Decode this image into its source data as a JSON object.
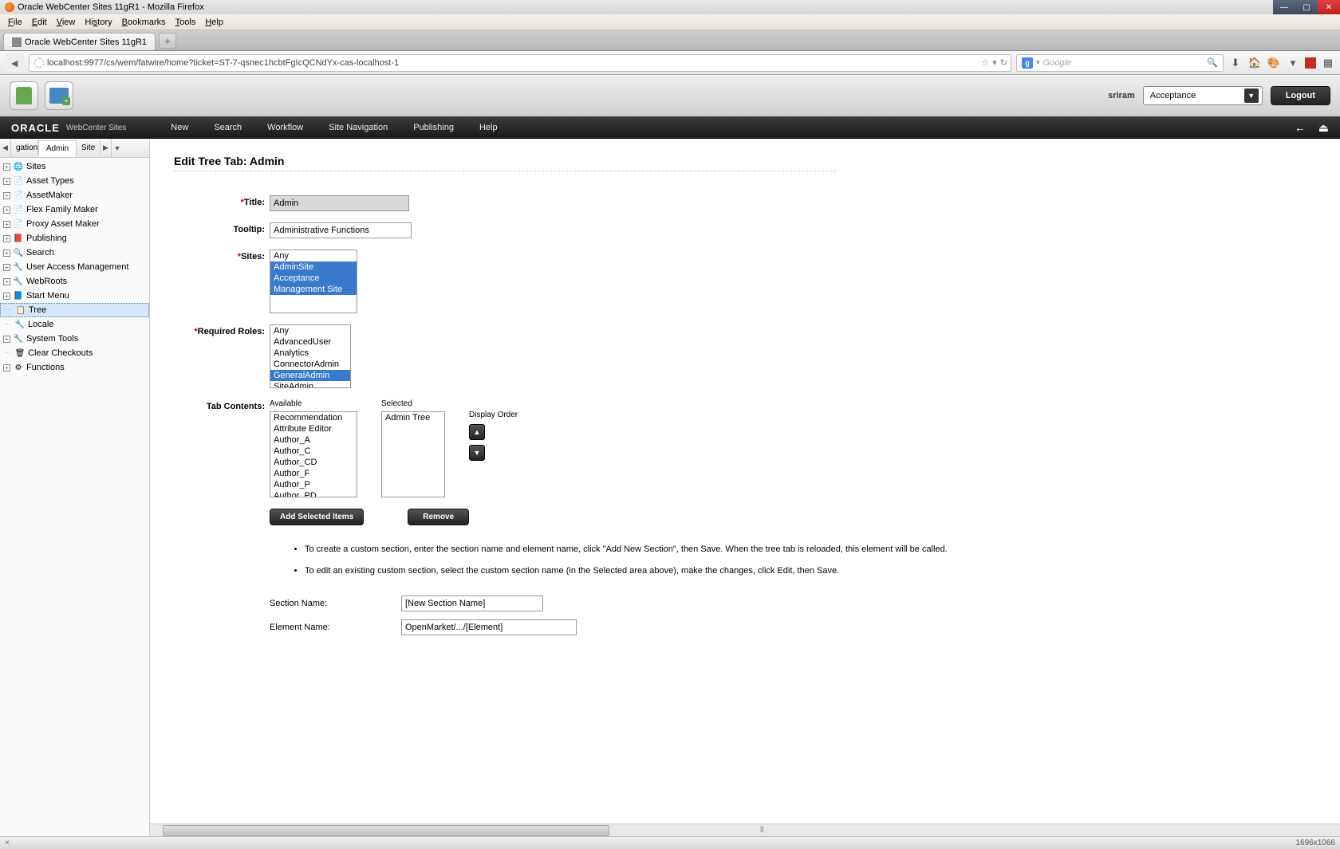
{
  "window": {
    "title": "Oracle WebCenter Sites 11gR1 - Mozilla Firefox"
  },
  "menubar": [
    "File",
    "Edit",
    "View",
    "History",
    "Bookmarks",
    "Tools",
    "Help"
  ],
  "tab": {
    "label": "Oracle WebCenter Sites 11gR1"
  },
  "url": "localhost:9977/cs/wem/fatwire/home?ticket=ST-7-qsnec1hcbtFgIcQCNdYx-cas-localhost-1",
  "search_placeholder": "Google",
  "user": "sriram",
  "site_select": "Acceptance",
  "logout": "Logout",
  "brand": {
    "name": "ORACLE",
    "product": "WebCenter Sites"
  },
  "topnav": [
    "New",
    "Search",
    "Workflow",
    "Site Navigation",
    "Publishing",
    "Help"
  ],
  "left_tabs": {
    "prev": "gation",
    "active": "Admin",
    "next": "Site"
  },
  "tree": [
    {
      "label": "Sites",
      "icon": "🌐",
      "exp": "+"
    },
    {
      "label": "Asset Types",
      "icon": "📄",
      "exp": "+"
    },
    {
      "label": "AssetMaker",
      "icon": "📄",
      "exp": "+"
    },
    {
      "label": "Flex Family Maker",
      "icon": "📄",
      "exp": "+"
    },
    {
      "label": "Proxy Asset Maker",
      "icon": "📄",
      "exp": "+"
    },
    {
      "label": "Publishing",
      "icon": "📕",
      "exp": "+"
    },
    {
      "label": "Search",
      "icon": "🔍",
      "exp": "+"
    },
    {
      "label": "User Access Management",
      "icon": "🔧",
      "exp": "+"
    },
    {
      "label": "WebRoots",
      "icon": "🔧",
      "exp": "+"
    },
    {
      "label": "Start Menu",
      "icon": "📘",
      "exp": "+"
    },
    {
      "label": "Tree",
      "icon": "📋",
      "exp": "",
      "selected": true
    },
    {
      "label": "Locale",
      "icon": "🔧",
      "exp": ""
    },
    {
      "label": "System Tools",
      "icon": "🔧",
      "exp": "+"
    },
    {
      "label": "Clear Checkouts",
      "icon": "🗑",
      "exp": ""
    },
    {
      "label": "Functions",
      "icon": "⚙",
      "exp": "+"
    }
  ],
  "page_title": "Edit Tree Tab: Admin",
  "form": {
    "title_label": "Title:",
    "title_value": "Admin",
    "tooltip_label": "Tooltip:",
    "tooltip_value": "Administrative Functions",
    "sites_label": "Sites:",
    "sites_options": [
      {
        "text": "Any",
        "sel": false
      },
      {
        "text": "AdminSite",
        "sel": true
      },
      {
        "text": "Acceptance",
        "sel": true
      },
      {
        "text": "Management Site",
        "sel": true
      }
    ],
    "roles_label": "Required Roles:",
    "roles_options": [
      {
        "text": "Any",
        "sel": false
      },
      {
        "text": "AdvancedUser",
        "sel": false
      },
      {
        "text": "Analytics",
        "sel": false
      },
      {
        "text": "ConnectorAdmin",
        "sel": false
      },
      {
        "text": "GeneralAdmin",
        "sel": true
      },
      {
        "text": "SiteAdmin",
        "sel": false
      }
    ],
    "tabcontents_label": "Tab Contents:",
    "available_label": "Available",
    "available_options": [
      "Recommendation",
      "Attribute Editor",
      "Author_A",
      "Author_C",
      "Author_CD",
      "Author_F",
      "Author_P",
      "Author_PD"
    ],
    "selected_label": "Selected",
    "selected_options": [
      "Admin Tree"
    ],
    "display_order_label": "Display Order",
    "add_btn": "Add Selected Items",
    "remove_btn": "Remove",
    "instructions": [
      "To create a custom section, enter the section name and element name, click \"Add New Section\", then Save. When the tree tab is reloaded, this element will be called.",
      "To edit an existing custom section, select the custom section name (in the Selected area above), make the changes, click Edit, then Save."
    ],
    "section_name_label": "Section Name:",
    "section_name_value": "[New Section Name]",
    "element_name_label": "Element Name:",
    "element_name_value": "OpenMarket/.../[Element]"
  },
  "status": {
    "dim": "1696x1066"
  }
}
